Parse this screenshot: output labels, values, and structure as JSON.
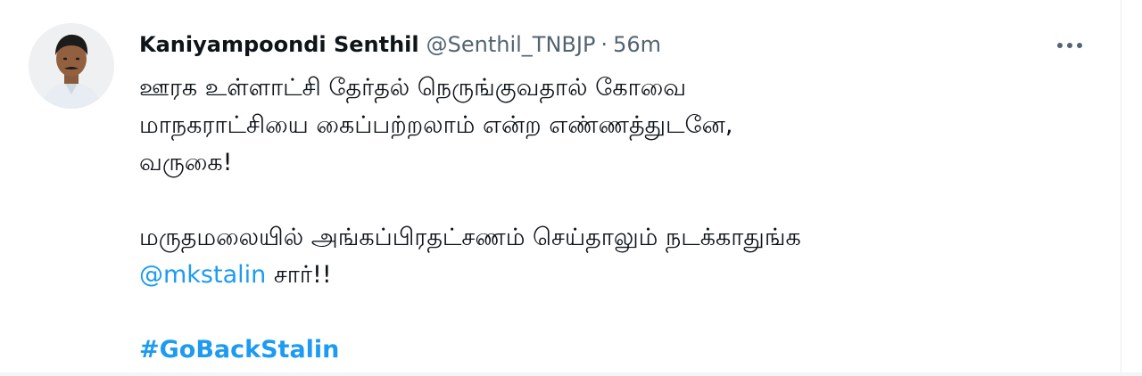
{
  "tweet": {
    "author_name": "Kaniyampoondi Senthil",
    "handle": "@Senthil_TNBJP",
    "separator": "·",
    "timestamp": "56m",
    "more_icon": "more-horizontal-icon",
    "text_lines": [
      "ஊரக உள்ளாட்சி தேர்தல் நெருங்குவதால் கோவை",
      "மாநகராட்சியை கைப்பற்றலாம் என்ற எண்ணத்துடனே,",
      "வருகை!",
      "மருதமலையில் அங்கப்பிரதட்சணம் செய்தாலும் நடக்காதுங்க"
    ],
    "mention": "@mkstalin",
    "mention_suffix": " சார்!!",
    "hashtag": "#GoBackStalin",
    "link_color": "#1d9bf0",
    "secondary_color": "#536471"
  }
}
